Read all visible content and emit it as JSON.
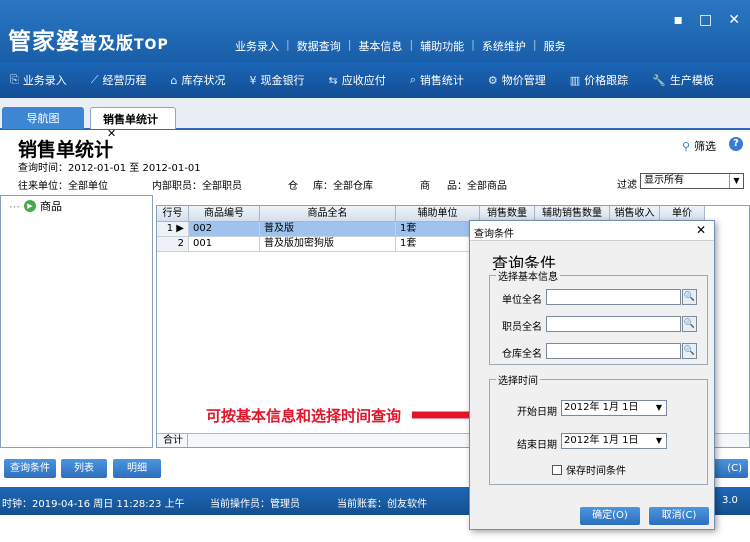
{
  "app": {
    "logo": "管家婆",
    "logo_sub": "普及版",
    "logo_top": "TOP",
    "top_menu": [
      "业务录入",
      "数据查询",
      "基本信息",
      "辅助功能",
      "系统维护",
      "服务"
    ],
    "window_buttons": [
      "▪",
      "□",
      "✕"
    ]
  },
  "toolbar": {
    "items": [
      {
        "icon": "document-icon",
        "glyph": "⎘",
        "label": "业务录入"
      },
      {
        "icon": "chart-icon",
        "glyph": "⟋",
        "label": "经营历程"
      },
      {
        "icon": "house-icon",
        "glyph": "⌂",
        "label": "库存状况"
      },
      {
        "icon": "yen-icon",
        "glyph": "¥",
        "label": "现金银行"
      },
      {
        "icon": "exchange-icon",
        "glyph": "⇆",
        "label": "应收应付"
      },
      {
        "icon": "search-icon",
        "glyph": "⌕",
        "label": "销售统计"
      },
      {
        "icon": "gear-icon",
        "glyph": "⚙",
        "label": "物价管理"
      },
      {
        "icon": "bars-icon",
        "glyph": "▥",
        "label": "价格跟踪"
      },
      {
        "icon": "wrench-icon",
        "glyph": "🔧",
        "label": "生产模板"
      }
    ]
  },
  "tabs": {
    "nav": "导航图",
    "sales": "销售单统计",
    "close": "✕"
  },
  "header": {
    "title": "销售单统计",
    "query_time": "查询时间：2012-01-01 至 2012-01-01",
    "unit": "往来单位：全部单位",
    "staff": "内部职员：全部职员",
    "warehouse_label": "仓",
    "warehouse_value": "库：全部仓库",
    "product_label": "商",
    "product_value": "品：全部商品",
    "filter_label": "过滤",
    "filter_value": "显示所有",
    "filter_link": "筛选",
    "help": "?"
  },
  "tree": {
    "root": "商品"
  },
  "grid": {
    "columns": [
      "行号",
      "商品编号",
      "商品全名",
      "辅助单位",
      "销售数量",
      "辅助销售数量",
      "销售收入",
      "单价"
    ],
    "rows": [
      {
        "no": "1",
        "code": "002",
        "name": "普及版",
        "unit": "1套"
      },
      {
        "no": "2",
        "code": "001",
        "name": "普及版加密狗版",
        "unit": "1套"
      }
    ],
    "total_label": "合计"
  },
  "bottom_buttons": {
    "query": "查询条件",
    "list": "列表",
    "detail": "明细",
    "right_partial": "(C)"
  },
  "status": {
    "clock": "时钟：2019-04-16 周日 11:28:23 上午",
    "operator": "当前操作员：管理员",
    "account": "当前账套：创友软件",
    "version": "3.0"
  },
  "dialog": {
    "title": "查询条件",
    "close": "✕",
    "heading": "查询条件",
    "basic_group": "选择基本信息",
    "unit_label": "单位全名",
    "staff_label": "职员全名",
    "warehouse_label": "仓库全名",
    "time_group": "选择时间",
    "start_label": "开始日期",
    "start_value": "2012年 1月 1日",
    "end_label": "结束日期",
    "end_value": "2012年 1月 1日",
    "save_time": "保存时间条件",
    "ok": "确定(O)",
    "cancel": "取消(C)"
  },
  "annotation": {
    "text": "可按基本信息和选择时间查询",
    "color": "#e2152a"
  }
}
